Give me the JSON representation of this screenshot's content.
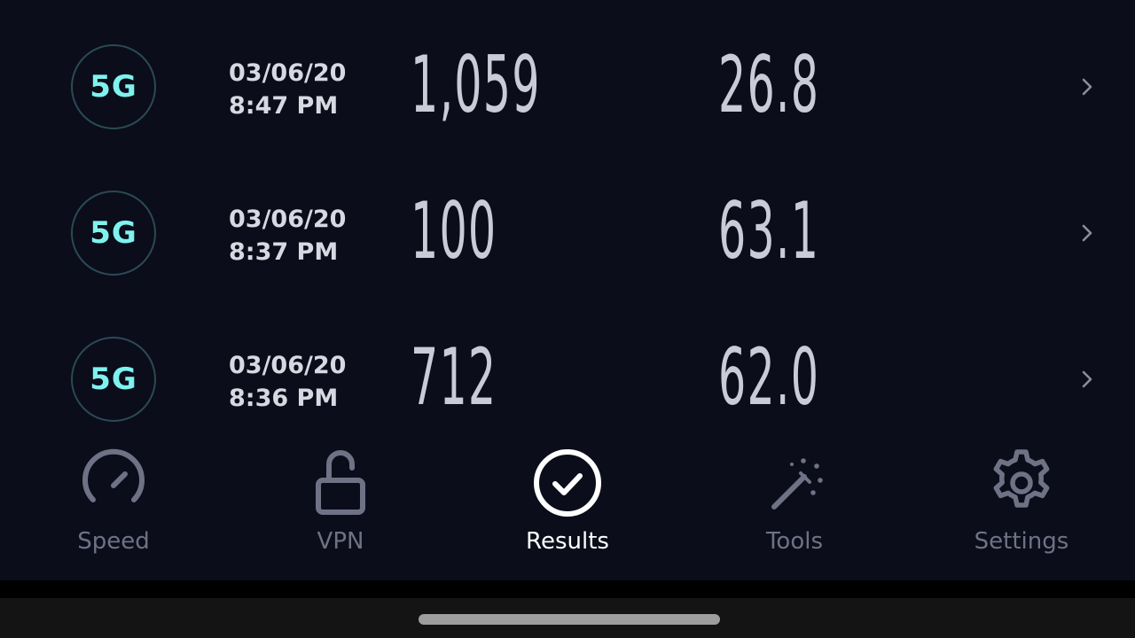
{
  "results": [
    {
      "connection": "5G",
      "date": "03/06/20",
      "time": "8:47 PM",
      "download": "1,059",
      "upload": "26.8"
    },
    {
      "connection": "5G",
      "date": "03/06/20",
      "time": "8:37 PM",
      "download": "100",
      "upload": "63.1"
    },
    {
      "connection": "5G",
      "date": "03/06/20",
      "time": "8:36 PM",
      "download": "712",
      "upload": "62.0"
    }
  ],
  "tabs": [
    {
      "label": "Speed",
      "icon": "speedometer-icon",
      "active": false
    },
    {
      "label": "VPN",
      "icon": "unlock-icon",
      "active": false
    },
    {
      "label": "Results",
      "icon": "check-circle-icon",
      "active": true
    },
    {
      "label": "Tools",
      "icon": "magic-wand-icon",
      "active": false
    },
    {
      "label": "Settings",
      "icon": "gear-icon",
      "active": false
    }
  ],
  "colors": {
    "background": "#0b0d1a",
    "accent_connection": "#7ef2ee",
    "inactive_tab": "#6f7285",
    "active_tab": "#ffffff"
  }
}
